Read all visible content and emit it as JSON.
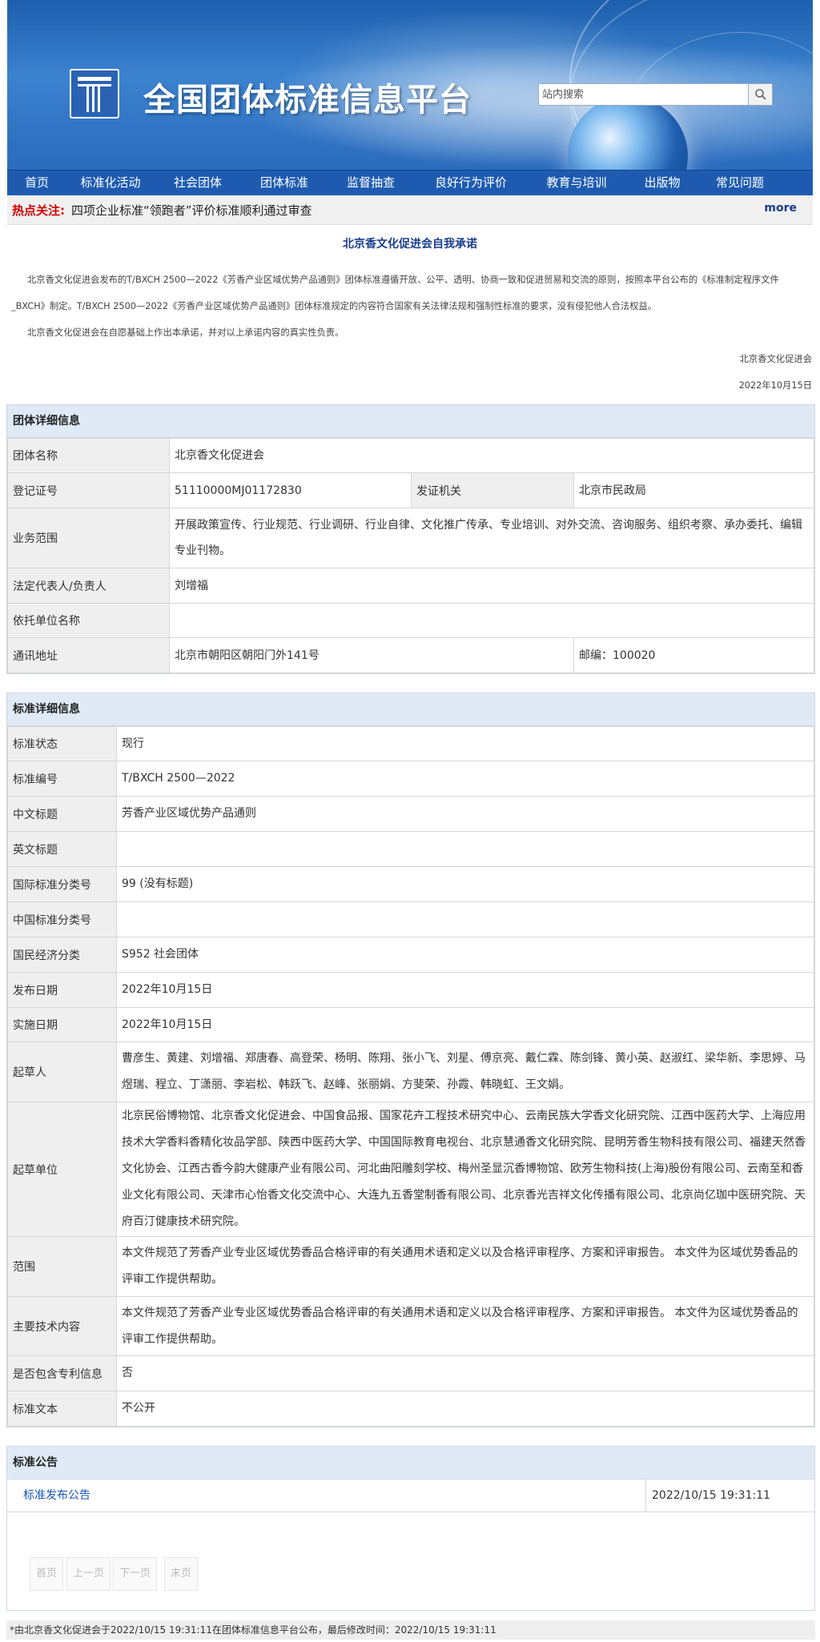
{
  "header": {
    "site_title": "全国团体标准信息平台",
    "search_placeholder": "站内搜索",
    "nav": [
      "首页",
      "标准化活动",
      "社会团体",
      "团体标准",
      "监督抽查",
      "良好行为评价",
      "教育与培训",
      "出版物",
      "常见问题"
    ]
  },
  "hotbar": {
    "label": "热点关注:",
    "text": "四项企业标准“领跑者”评价标准顺利通过审查",
    "more": "more"
  },
  "statement": {
    "title": "北京香文化促进会自我承诺",
    "para1": "北京香文化促进会发布的T/BXCH 2500—2022《芳香产业区域优势产品通则》团体标准遵循开放、公平、透明、协商一致和促进贸易和交流的原则，按照本平台公布的《标准制定程序文件_BXCH》制定。T/BXCH 2500—2022《芳香产业区域优势产品通则》团体标准规定的内容符合国家有关法律法规和强制性标准的要求，没有侵犯他人合法权益。",
    "para2": "北京香文化促进会在自愿基础上作出本承诺，并对以上承诺内容的真实性负责。",
    "sign": "北京香文化促进会",
    "date": "2022年10月15日"
  },
  "group": {
    "header": "团体详细信息",
    "name_label": "团体名称",
    "name": "北京香文化促进会",
    "reg_label": "登记证号",
    "reg": "51110000MJ01172830",
    "issuer_label": "发证机关",
    "issuer": "北京市民政局",
    "scope_label": "业务范围",
    "scope": "开展政策宣传、行业规范、行业调研、行业自律、文化推广传承、专业培训、对外交流、咨询服务、组织考察、承办委托、编辑专业刊物。",
    "rep_label": "法定代表人/负责人",
    "rep": "刘增福",
    "parent_label": "依托单位名称",
    "parent": "",
    "addr_label": "通讯地址",
    "addr": "北京市朝阳区朝阳门外141号",
    "postcode": "邮编：100020"
  },
  "standard": {
    "header": "标准详细信息",
    "rows": [
      {
        "k": "标准状态",
        "v": "现行"
      },
      {
        "k": "标准编号",
        "v": "T/BXCH 2500—2022"
      },
      {
        "k": "中文标题",
        "v": "芳香产业区域优势产品通则"
      },
      {
        "k": "英文标题",
        "v": ""
      },
      {
        "k": "国际标准分类号",
        "v": "99 (没有标题)"
      },
      {
        "k": "中国标准分类号",
        "v": ""
      },
      {
        "k": "国民经济分类",
        "v": "S952 社会团体"
      },
      {
        "k": "发布日期",
        "v": "2022年10月15日"
      },
      {
        "k": "实施日期",
        "v": "2022年10月15日"
      },
      {
        "k": "起草人",
        "v": "曹彦生、黄建、刘增福、郑唐春、高登荣、杨明、陈翔、张小飞、刘星、傅京亮、戴仁霖、陈剑锋、黄小英、赵淑红、梁华新、李思婷、马煜瑞、程立、丁潇丽、李岩松、韩跃飞、赵峰、张丽娟、方斐荣、孙霞、韩晓虹、王文娟。"
      },
      {
        "k": "起草单位",
        "v": "北京民俗博物馆、北京香文化促进会、中国食品报、国家花卉工程技术研究中心、云南民族大学香文化研究院、江西中医药大学、上海应用技术大学香料香精化妆品学部、陕西中医药大学、中国国际教育电视台、北京慧通香文化研究院、昆明芳香生物科技有限公司、福建天然香文化协会、江西古香今韵大健康产业有限公司、河北曲阳雕刻学校、梅州圣显沉香博物馆、欧芳生物科技(上海)股份有限公司、云南至和香业文化有限公司、天津市心怡香文化交流中心、大连九五香堂制香有限公司、北京香光吉祥文化传播有限公司、北京尚亿珈中医研究院、天府百汀健康技术研究院。"
      },
      {
        "k": "范围",
        "v": "本文件规范了芳香产业专业区域优势香品合格评审的有关通用术语和定义以及合格评审程序、方案和评审报告。 本文件为区域优势香品的评审工作提供帮助。"
      },
      {
        "k": "主要技术内容",
        "v": "本文件规范了芳香产业专业区域优势香品合格评审的有关通用术语和定义以及合格评审程序、方案和评审报告。 本文件为区域优势香品的评审工作提供帮助。"
      },
      {
        "k": "是否包含专利信息",
        "v": "否"
      },
      {
        "k": "标准文本",
        "v": "不公开"
      }
    ]
  },
  "announcement": {
    "header": "标准公告",
    "link": "标准发布公告",
    "date": "2022/10/15 19:31:11",
    "pager": [
      "首页",
      "上一页",
      "下一页",
      "末页"
    ]
  },
  "footer": {
    "note": "*由北京香文化促进会于2022/10/15 19:31:11在团体标准信息平台公布，最后修改时间：2022/10/15 19:31:11"
  },
  "colors": {
    "nav_bg": "#1e5bb0",
    "hot_label": "#d40000",
    "section_header_bg": "#dfeaf6",
    "link": "#1a55b8"
  }
}
